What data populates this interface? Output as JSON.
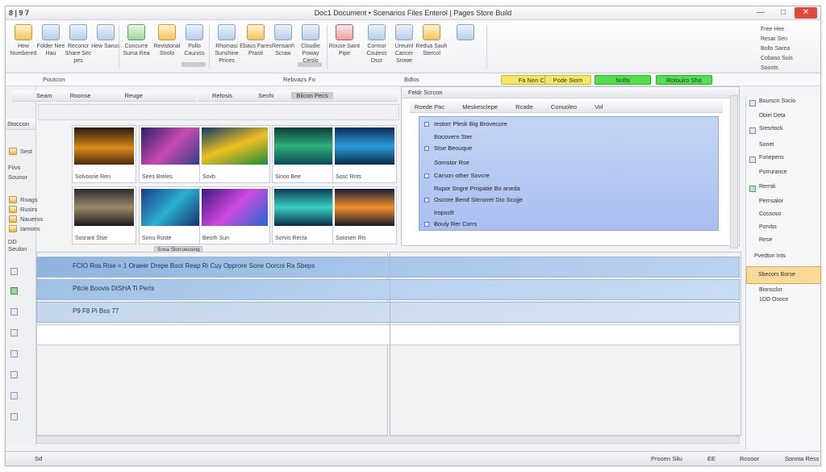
{
  "titlebar": {
    "quick_access": "8 | 9 7",
    "title": "Doc1  Document  •  Scenarios  Files    Enterol  |  Pages  Store  Build",
    "minimize": "—",
    "maximize": "□",
    "close": "✕"
  },
  "ribbon": {
    "buttons": [
      {
        "label": "Hew Numbered"
      },
      {
        "label": "Folder Nee Hau"
      },
      {
        "label": "Reconcr Share Sec pes"
      },
      {
        "label": "Hew Sanus"
      },
      {
        "label": "Concurre Suma Rea"
      },
      {
        "label": "Revistonal Strolo"
      },
      {
        "label": "Pollo Cauniss"
      },
      {
        "label": "Rhomasi Sunshine Prices"
      },
      {
        "label": "Ebaus Fares Prasti"
      },
      {
        "label": "Rensanh Scraw"
      },
      {
        "label": "Cloudie Poway Cieslo"
      },
      {
        "label": "Rouse Saint Pipe"
      },
      {
        "label": "Cormor Couless Oscr"
      },
      {
        "label": "Ureuml Cancer Srowe"
      },
      {
        "label": "Redua Sauh Stercol"
      }
    ],
    "right_labels": [
      "Free Hee",
      "Resar Sen",
      "Bollo Sarea",
      "Cobaso Suis"
    ],
    "right_small": "Soonts"
  },
  "toolbar2": {
    "left": "Poutcon",
    "center": "Rebvazs Fo",
    "mid": "Bdlos",
    "badges": [
      "Fa Nen Cedo",
      "Pode Siom",
      "Nolfa",
      "Rotouiro Sha"
    ]
  },
  "left_nav": {
    "header": "Stoccon",
    "items": [
      "Sest",
      "Fiivs",
      "Sounor",
      "Roags",
      "Rusirs",
      "Naueros",
      "Iamons",
      "Rossnr",
      "DD Seulon"
    ]
  },
  "thumbs_panel": {
    "tabs": [
      "Seam",
      "Roonse",
      "Reuge"
    ],
    "sub_tabs": [
      "Refosis",
      "Senhi",
      "Bilcon Pecs"
    ],
    "items": [
      {
        "caption": "Solvoorie Ren"
      },
      {
        "caption": "Sees Breles"
      },
      {
        "caption": "Sovb"
      },
      {
        "caption": "Sinos Bee"
      },
      {
        "caption": "Sosc Rnts"
      },
      {
        "caption": "Sosrant Stse"
      },
      {
        "caption": "Sonu Roste"
      },
      {
        "caption": "Beorh Sun"
      },
      {
        "caption": "Sorvis Recta"
      },
      {
        "caption": "Sotosen Ris"
      }
    ],
    "footer": "Sosa Slorroessing"
  },
  "right_panel": {
    "header": "Feldr Scrcon",
    "tabs": [
      "Roede Pac",
      "Meskesclepe",
      "Rcade",
      "Conuoleo",
      "Vol"
    ],
    "items": [
      "Iestorr Plesk Big Brovecore",
      "Bocovern Ster",
      "Stse Beouque",
      "Sornstor Rse",
      "Carson other Sovcre",
      "Rupor Sngre Propatie Bo aneda",
      "Oscore Bend Sitrnoret Dio Scojje",
      "Iropsolt",
      "Bouly Rer Corrs"
    ]
  },
  "grid": {
    "rows": [
      {
        "text": "FCIO Ros Rise = 1 Oraeer Drepe Boot Reap Ri Cuy Opprore Sone Oorcoi Ra Sbeps"
      },
      {
        "text": "Pitcie Boovis DISHA Ti Perts"
      },
      {
        "text": "P9 F8 Pi Bss 77"
      }
    ]
  },
  "right_sidebar": {
    "items": [
      "Bourscn Socio",
      "Dbiei Deta",
      "Sresrtock",
      "Sonet",
      "Fsnepens",
      "Porrurance",
      "Rerrsk",
      "Pernsalor",
      "Cossoso",
      "Porvbs",
      "Rese",
      "Pvedton Ints"
    ],
    "highlight": "Sbecors Borse",
    "below": [
      "Bionsclor",
      "1DD Osoce"
    ]
  },
  "statusbar": {
    "left": "Sd",
    "right1": "Prooen Silu",
    "right2": "EE",
    "right3": "Rosoor",
    "right4": "Sonnia Ress"
  },
  "colors": {
    "accent_blue": "#a9c6ec",
    "accent_yellow": "#f4e660",
    "accent_green": "#4fe04a",
    "highlight_orange": "#fbd99a"
  }
}
